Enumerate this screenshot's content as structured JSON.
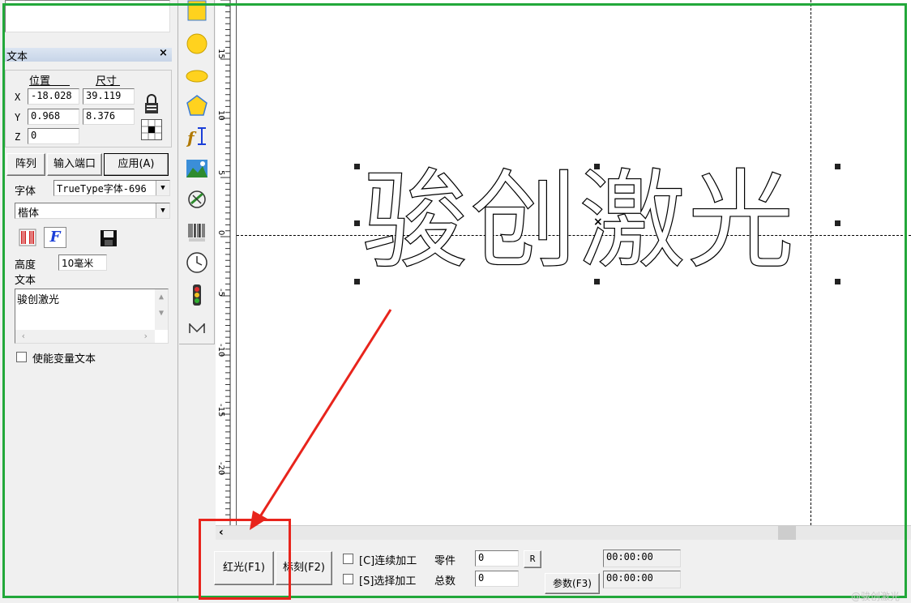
{
  "panel": {
    "title": "文本",
    "close": "×",
    "position_label": "位置",
    "size_label": "尺寸",
    "x_label": "X",
    "y_label": "Y",
    "z_label": "Z",
    "x_value": "-18.028",
    "y_value": "0.968",
    "z_value": "0",
    "width_value": "39.119",
    "height_value": "8.376",
    "buttons": {
      "array": "阵列",
      "input_port": "输入端口",
      "apply": "应用(A)"
    },
    "font_label": "字体",
    "font_type_value": "TrueType字体-696",
    "font_name_value": "楷体",
    "height_label": "高度",
    "height_field_value": "10毫米",
    "text_label": "文本",
    "text_value": "骏创激光",
    "variable_text_label": "使能变量文本"
  },
  "canvas": {
    "text": "骏创激光",
    "ruler_labels": [
      "15",
      "10",
      "5",
      "0",
      "-5",
      "-10",
      "-15",
      "-20"
    ]
  },
  "bottom": {
    "red_light": "红光(F1)",
    "mark": "标刻(F2)",
    "continuous_label": "[C]连续加工",
    "select_label": "[S]选择加工",
    "parts_label": "零件",
    "total_label": "总数",
    "parts_value": "0",
    "total_value": "0",
    "r_button": "R",
    "params_button": "参数(F3)",
    "time1": "00:00:00",
    "time2": "00:00:00"
  },
  "watermark": "@骏创激光",
  "colors": {
    "highlight_green": "#22a83a",
    "highlight_red": "#e8241c",
    "arrow": "#e8241c"
  }
}
